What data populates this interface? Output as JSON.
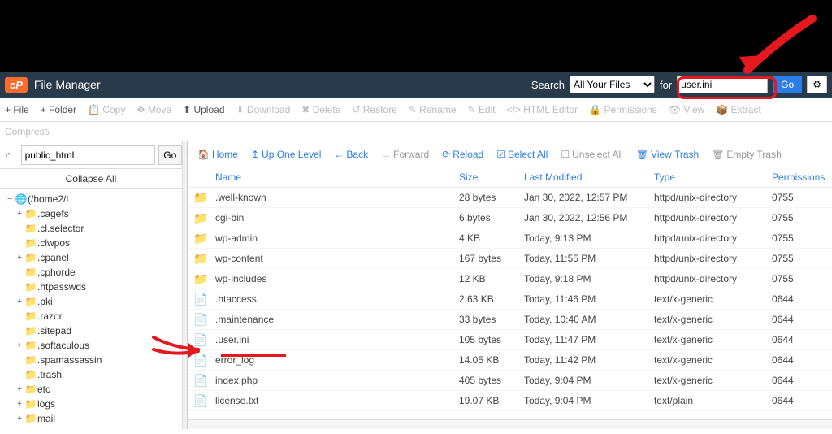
{
  "header": {
    "logo": "cP",
    "title": "File Manager",
    "search_label": "Search",
    "select_value": "All Your Files",
    "for_label": "for",
    "search_value": "user.ini",
    "go": "Go",
    "settings_icon": "⚙"
  },
  "toolbar": [
    {
      "label": "+ File",
      "disabled": false
    },
    {
      "label": "+ Folder",
      "disabled": false
    },
    {
      "label": "📋 Copy",
      "disabled": true
    },
    {
      "label": "✥ Move",
      "disabled": true
    },
    {
      "label": "⬆ Upload",
      "disabled": false
    },
    {
      "label": "⬇ Download",
      "disabled": true
    },
    {
      "label": "✖ Delete",
      "disabled": true
    },
    {
      "label": "↺ Restore",
      "disabled": true
    },
    {
      "label": "✎ Rename",
      "disabled": true
    },
    {
      "label": "✎ Edit",
      "disabled": true
    },
    {
      "label": "</> HTML Editor",
      "disabled": true
    },
    {
      "label": "🔒 Permissions",
      "disabled": true
    },
    {
      "label": "👁 View",
      "disabled": true
    },
    {
      "label": "📦 Extract",
      "disabled": true
    }
  ],
  "toolbar2": {
    "compress": "Compress"
  },
  "left": {
    "path_value": "public_html",
    "go": "Go",
    "collapse": "Collapse All",
    "root": {
      "toggle": "−",
      "label": "(/home2/t"
    }
  },
  "tree": [
    {
      "toggle": "+",
      "label": ".cagefs",
      "depth": 2
    },
    {
      "toggle": "",
      "label": ".cl.selector",
      "depth": 2
    },
    {
      "toggle": "",
      "label": ".clwpos",
      "depth": 2
    },
    {
      "toggle": "+",
      "label": ".cpanel",
      "depth": 2
    },
    {
      "toggle": "",
      "label": ".cphorde",
      "depth": 2
    },
    {
      "toggle": "",
      "label": ".htpasswds",
      "depth": 2
    },
    {
      "toggle": "+",
      "label": ".pki",
      "depth": 2
    },
    {
      "toggle": "",
      "label": ".razor",
      "depth": 2
    },
    {
      "toggle": "",
      "label": ".sitepad",
      "depth": 2
    },
    {
      "toggle": "+",
      "label": ".softaculous",
      "depth": 2
    },
    {
      "toggle": "",
      "label": ".spamassassin",
      "depth": 2
    },
    {
      "toggle": "",
      "label": ".trash",
      "depth": 2
    },
    {
      "toggle": "+",
      "label": "etc",
      "depth": 2
    },
    {
      "toggle": "+",
      "label": "logs",
      "depth": 2
    },
    {
      "toggle": "+",
      "label": "mail",
      "depth": 2
    }
  ],
  "file_toolbar": {
    "home": "Home",
    "up": "Up One Level",
    "back": "Back",
    "forward": "Forward",
    "reload": "Reload",
    "select_all": "Select All",
    "unselect_all": "Unselect All",
    "view_trash": "View Trash",
    "empty_trash": "Empty Trash"
  },
  "columns": {
    "name": "Name",
    "size": "Size",
    "modified": "Last Modified",
    "type": "Type",
    "perm": "Permissions"
  },
  "files": [
    {
      "icon": "folder",
      "name": ".well-known",
      "size": "28 bytes",
      "modified": "Jan 30, 2022, 12:57 PM",
      "type": "httpd/unix-directory",
      "perm": "0755"
    },
    {
      "icon": "folder",
      "name": "cgi-bin",
      "size": "6 bytes",
      "modified": "Jan 30, 2022, 12:56 PM",
      "type": "httpd/unix-directory",
      "perm": "0755"
    },
    {
      "icon": "folder",
      "name": "wp-admin",
      "size": "4 KB",
      "modified": "Today, 9:13 PM",
      "type": "httpd/unix-directory",
      "perm": "0755"
    },
    {
      "icon": "folder",
      "name": "wp-content",
      "size": "167 bytes",
      "modified": "Today, 11:55 PM",
      "type": "httpd/unix-directory",
      "perm": "0755"
    },
    {
      "icon": "folder",
      "name": "wp-includes",
      "size": "12 KB",
      "modified": "Today, 9:18 PM",
      "type": "httpd/unix-directory",
      "perm": "0755"
    },
    {
      "icon": "file",
      "name": ".htaccess",
      "size": "2.63 KB",
      "modified": "Today, 11:46 PM",
      "type": "text/x-generic",
      "perm": "0644"
    },
    {
      "icon": "file",
      "name": ".maintenance",
      "size": "33 bytes",
      "modified": "Today, 10:40 AM",
      "type": "text/x-generic",
      "perm": "0644"
    },
    {
      "icon": "file",
      "name": ".user.ini",
      "size": "105 bytes",
      "modified": "Today, 11:47 PM",
      "type": "text/x-generic",
      "perm": "0644"
    },
    {
      "icon": "file",
      "name": "error_log",
      "size": "14.05 KB",
      "modified": "Today, 11:42 PM",
      "type": "text/x-generic",
      "perm": "0644"
    },
    {
      "icon": "file",
      "name": "index.php",
      "size": "405 bytes",
      "modified": "Today, 9:04 PM",
      "type": "text/x-generic",
      "perm": "0644"
    },
    {
      "icon": "file",
      "name": "license.txt",
      "size": "19.07 KB",
      "modified": "Today, 9:04 PM",
      "type": "text/plain",
      "perm": "0644"
    }
  ]
}
